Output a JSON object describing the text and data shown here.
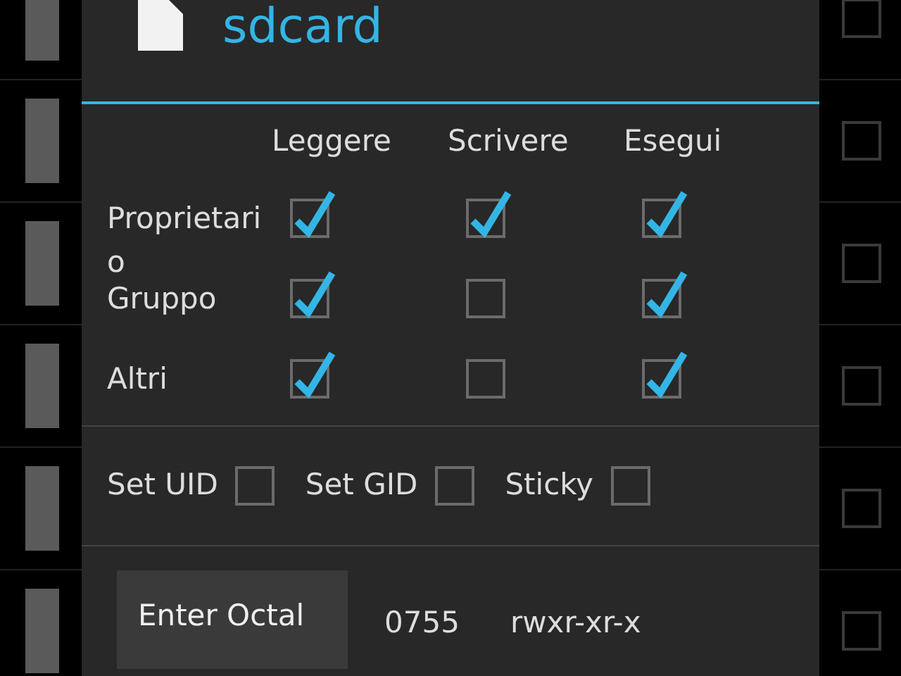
{
  "background_list": [
    {
      "checked": false
    },
    {
      "checked": false
    },
    {
      "checked": false
    },
    {
      "checked": false
    },
    {
      "checked": false
    },
    {
      "checked": false
    }
  ],
  "dialog": {
    "title": "sdcard",
    "columns": [
      "Leggere",
      "Scrivere",
      "Esegui"
    ],
    "rows": [
      {
        "label": "Proprietario",
        "checks": [
          true,
          true,
          true
        ]
      },
      {
        "label": "Gruppo",
        "checks": [
          true,
          false,
          true
        ]
      },
      {
        "label": "Altri",
        "checks": [
          true,
          false,
          true
        ]
      }
    ],
    "flags": [
      {
        "label": "Set UID",
        "checked": false
      },
      {
        "label": "Set GID",
        "checked": false
      },
      {
        "label": "Sticky",
        "checked": false
      }
    ],
    "button": "Enter Octal",
    "octal": "0755",
    "symbolic": "rwxr-xr-x"
  }
}
